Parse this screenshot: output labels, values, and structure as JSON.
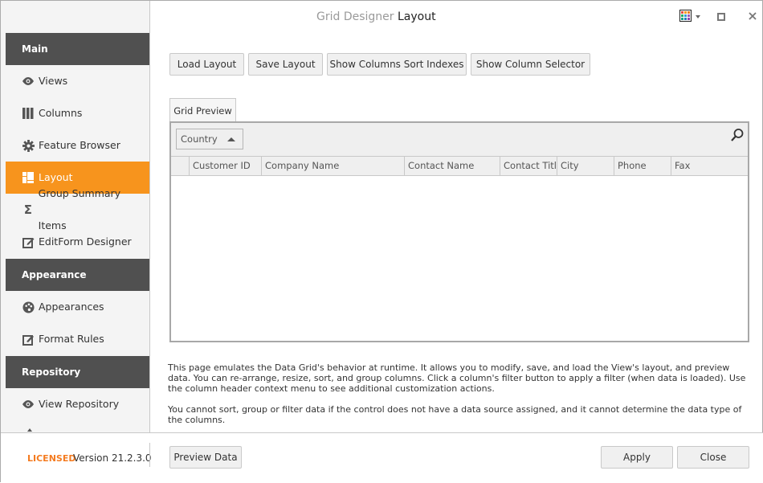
{
  "window": {
    "title_prefix": "Grid Designer",
    "title_page": "Layout",
    "controls": {
      "skin_icon": "palette-grid-icon",
      "dropdown_icon": "chevron-down-icon",
      "maximize_icon": "maximize-icon",
      "close_icon": "close-icon"
    }
  },
  "sidebar": {
    "groups": [
      {
        "label": "Main"
      },
      {
        "label": "Appearance"
      },
      {
        "label": "Repository"
      }
    ],
    "items": [
      {
        "label": "Views",
        "icon": "eye-icon"
      },
      {
        "label": "Columns",
        "icon": "columns-icon"
      },
      {
        "label": "Feature Browser",
        "icon": "gear-icon"
      },
      {
        "label": "Layout",
        "icon": "layout-icon",
        "active": true
      },
      {
        "label": "Group Summary Items",
        "icon": "sigma-icon"
      },
      {
        "label": "EditForm Designer",
        "icon": "edit-form-icon"
      },
      {
        "label": "Appearances",
        "icon": "palette-icon"
      },
      {
        "label": "Format Rules",
        "icon": "format-rules-icon"
      },
      {
        "label": "View Repository",
        "icon": "eye-icon"
      }
    ]
  },
  "toolbar": {
    "load_layout": "Load Layout",
    "save_layout": "Save Layout",
    "show_sort_indexes": "Show Columns Sort Indexes",
    "show_column_selector": "Show Column Selector"
  },
  "preview": {
    "tab_label": "Grid Preview",
    "group_by_column": "Country",
    "columns": [
      "Customer ID",
      "Company Name",
      "Contact Name",
      "Contact Title",
      "City",
      "Phone",
      "Fax"
    ]
  },
  "description": {
    "paragraph1": "This page emulates the Data Grid's behavior at runtime. It allows you to modify, save, and load the View's layout, and preview data. You can re-arrange, resize, sort, and group columns. Click a column's filter button to apply a filter (when data is loaded). Use the column header context menu to see additional customization actions.",
    "paragraph2": "You cannot sort, group or filter data if the control does not have a data source assigned, and it cannot determine the data type of the columns."
  },
  "footer": {
    "licensed": "LICENSED",
    "version": "Version 21.2.3.0",
    "preview_data": "Preview Data",
    "apply": "Apply",
    "close": "Close"
  },
  "colors": {
    "accent": "#f7941d",
    "group_header": "#505050",
    "licensed": "#f47b20"
  }
}
